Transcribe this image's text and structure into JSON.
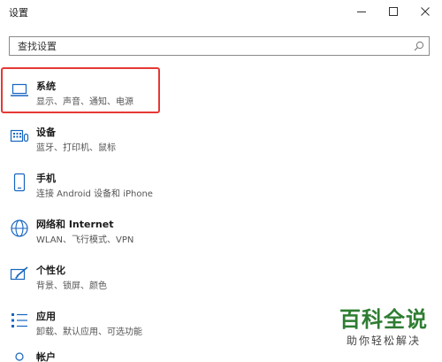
{
  "window": {
    "title": "设置"
  },
  "search": {
    "placeholder": "查找设置"
  },
  "items": [
    {
      "label": "系统",
      "desc": "显示、声音、通知、电源"
    },
    {
      "label": "设备",
      "desc": "蓝牙、打印机、鼠标"
    },
    {
      "label": "手机",
      "desc": "连接 Android 设备和 iPhone"
    },
    {
      "label": "网络和 Internet",
      "desc": "WLAN、飞行模式、VPN"
    },
    {
      "label": "个性化",
      "desc": "背景、锁屏、颜色"
    },
    {
      "label": "应用",
      "desc": "卸载、默认应用、可选功能"
    },
    {
      "label": "帐户",
      "desc": ""
    }
  ],
  "watermark": {
    "main": "百科全说",
    "sub": "助你轻松解决"
  },
  "colors": {
    "highlight": "#e53935",
    "icon_blue": "#1565c0",
    "watermark_green": "#2e7d32"
  }
}
